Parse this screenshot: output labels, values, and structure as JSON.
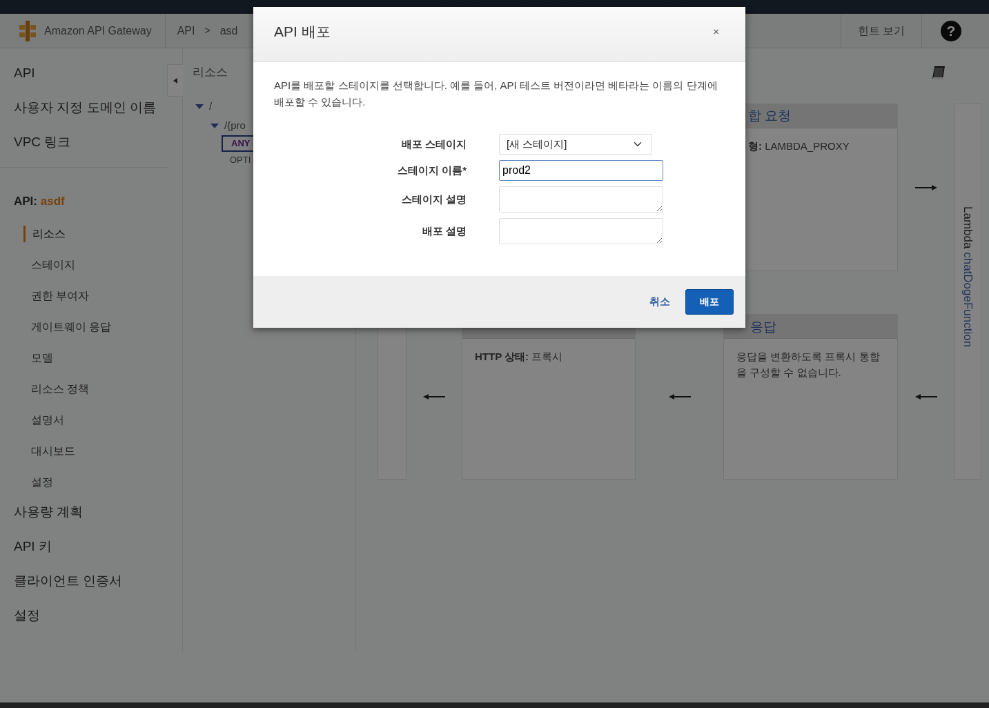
{
  "header": {
    "product": "Amazon API Gateway",
    "breadcrumbs": [
      {
        "label": "API"
      },
      {
        "label": "asd"
      }
    ],
    "separator": ">",
    "hint": "힌트 보기",
    "help": "?"
  },
  "sidebar": {
    "top_items": [
      {
        "label": "API"
      },
      {
        "label": "사용자 지정 도메인 이름"
      },
      {
        "label": "VPC 링크"
      }
    ],
    "api_label": "API:",
    "api_name": "asdf",
    "api_items": [
      {
        "label": "리소스",
        "selected": true
      },
      {
        "label": "스테이지",
        "selected": false
      },
      {
        "label": "권한 부여자",
        "selected": false
      },
      {
        "label": "게이트웨이 응답",
        "selected": false
      },
      {
        "label": "모델",
        "selected": false
      },
      {
        "label": "리소스 정책",
        "selected": false
      },
      {
        "label": "설명서",
        "selected": false
      },
      {
        "label": "대시보드",
        "selected": false
      },
      {
        "label": "설정",
        "selected": false
      }
    ],
    "bottom_items": [
      {
        "label": "사용량 계획"
      },
      {
        "label": "API 키"
      },
      {
        "label": "클라이언트 인증서"
      },
      {
        "label": "설정"
      }
    ]
  },
  "resources": {
    "title": "리소스",
    "tree": [
      {
        "label": "/",
        "expanded": true,
        "children": [
          {
            "label": "/{pro",
            "expanded": true,
            "children": [
              {
                "label": "ANY",
                "selected": true
              },
              {
                "label": "OPTI",
                "selected": false
              }
            ]
          }
        ]
      }
    ]
  },
  "diagram": {
    "integration_request": {
      "title": "합 요청",
      "type_label": "형:",
      "type_value": "LAMBDA_PROXY"
    },
    "method_response": {
      "status_label": "HTTP 상태:",
      "status_value": "프록시"
    },
    "integration_response": {
      "title": "응답",
      "note": "응답을 변환하도록 프록시 통합을 구성할 수 없습니다."
    },
    "lambda": {
      "label": "Lambda",
      "function": "chatDogeFunction"
    }
  },
  "dialog": {
    "title": "API 배포",
    "close": "×",
    "description": "API를 배포할 스테이지를 선택합니다. 예를 들어, API 테스트 버전이라면 베타라는 이름의 단계에 배포할 수 있습니다.",
    "fields": [
      {
        "kind": "select",
        "label": "배포 스테이지",
        "value": "[새 스테이지]"
      },
      {
        "kind": "text",
        "label": "스테이지 이름*",
        "value": "prod2"
      },
      {
        "kind": "textarea",
        "label": "스테이지 설명"
      },
      {
        "kind": "textarea",
        "label": "배포 설명"
      }
    ],
    "cancel": "취소",
    "submit": "배포"
  }
}
